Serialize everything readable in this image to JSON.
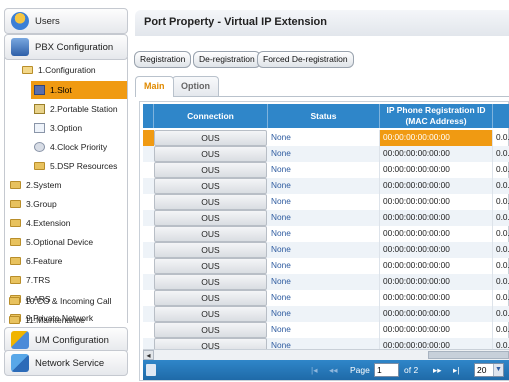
{
  "sidebar": {
    "users_label": "Users",
    "pbx_config_label": "PBX Configuration",
    "tree": [
      {
        "label": "1.Configuration",
        "type": "folder-open"
      },
      {
        "label": "1.Slot",
        "type": "page",
        "selected": true
      },
      {
        "label": "2.Portable Station",
        "type": "page"
      },
      {
        "label": "3.Option",
        "type": "page"
      },
      {
        "label": "4.Clock Priority",
        "type": "page"
      },
      {
        "label": "5.DSP Resources",
        "type": "folder"
      },
      {
        "label": "2.System",
        "type": "folder"
      },
      {
        "label": "3.Group",
        "type": "folder"
      },
      {
        "label": "4.Extension",
        "type": "folder"
      },
      {
        "label": "5.Optional Device",
        "type": "folder"
      },
      {
        "label": "6.Feature",
        "type": "folder"
      },
      {
        "label": "7.TRS",
        "type": "folder"
      },
      {
        "label": "8.ARS",
        "type": "folder"
      },
      {
        "label": "9.Private Network",
        "type": "folder"
      },
      {
        "label": "10.CO & Incoming Call",
        "type": "folder"
      },
      {
        "label": "11.Maintenance",
        "type": "folder"
      }
    ],
    "um_config_label": "UM Configuration",
    "network_service_label": "Network Service"
  },
  "main": {
    "title": "Port Property - Virtual IP Extension",
    "buttons": {
      "registration": "Registration",
      "deregistration": "De-registration",
      "forced_deregistration": "Forced De-registration"
    },
    "tabs": {
      "main": "Main",
      "option": "Option"
    },
    "grid": {
      "headers": {
        "connection": "Connection",
        "status": "Status",
        "mac": "IP Phone Registration ID\n(MAC Address)"
      },
      "rows": [
        {
          "connection": "OUS",
          "status": "None",
          "mac": "00:00:00:00:00:00",
          "extra": "0.0.",
          "selected": true
        },
        {
          "connection": "OUS",
          "status": "None",
          "mac": "00:00:00:00:00:00",
          "extra": "0.0."
        },
        {
          "connection": "OUS",
          "status": "None",
          "mac": "00:00:00:00:00:00",
          "extra": "0.0."
        },
        {
          "connection": "OUS",
          "status": "None",
          "mac": "00:00:00:00:00:00",
          "extra": "0.0."
        },
        {
          "connection": "OUS",
          "status": "None",
          "mac": "00:00:00:00:00:00",
          "extra": "0.0."
        },
        {
          "connection": "OUS",
          "status": "None",
          "mac": "00:00:00:00:00:00",
          "extra": "0.0."
        },
        {
          "connection": "OUS",
          "status": "None",
          "mac": "00:00:00:00:00:00",
          "extra": "0.0."
        },
        {
          "connection": "OUS",
          "status": "None",
          "mac": "00:00:00:00:00:00",
          "extra": "0.0."
        },
        {
          "connection": "OUS",
          "status": "None",
          "mac": "00:00:00:00:00:00",
          "extra": "0.0."
        },
        {
          "connection": "OUS",
          "status": "None",
          "mac": "00:00:00:00:00:00",
          "extra": "0.0."
        },
        {
          "connection": "OUS",
          "status": "None",
          "mac": "00:00:00:00:00:00",
          "extra": "0.0."
        },
        {
          "connection": "OUS",
          "status": "None",
          "mac": "00:00:00:00:00:00",
          "extra": "0.0."
        },
        {
          "connection": "OUS",
          "status": "None",
          "mac": "00:00:00:00:00:00",
          "extra": "0.0."
        },
        {
          "connection": "OUS",
          "status": "None",
          "mac": "00:00:00:00:00:00",
          "extra": "0.0."
        }
      ]
    },
    "pager": {
      "page_label": "Page",
      "current_page": "1",
      "of_label": "of 2",
      "page_size": "20",
      "first_glyph": "|◂",
      "prev_glyph": "◂◂",
      "next_glyph": "▸▸",
      "last_glyph": "▸|"
    }
  },
  "colors": {
    "accent_orange": "#f09a12",
    "grid_header_blue": "#2f86c9",
    "status_link_blue": "#2f5ca0"
  },
  "icons": {
    "users": "users-icon",
    "pbx": "pbx-config-icon",
    "um": "um-config-icon",
    "network": "network-service-icon"
  }
}
